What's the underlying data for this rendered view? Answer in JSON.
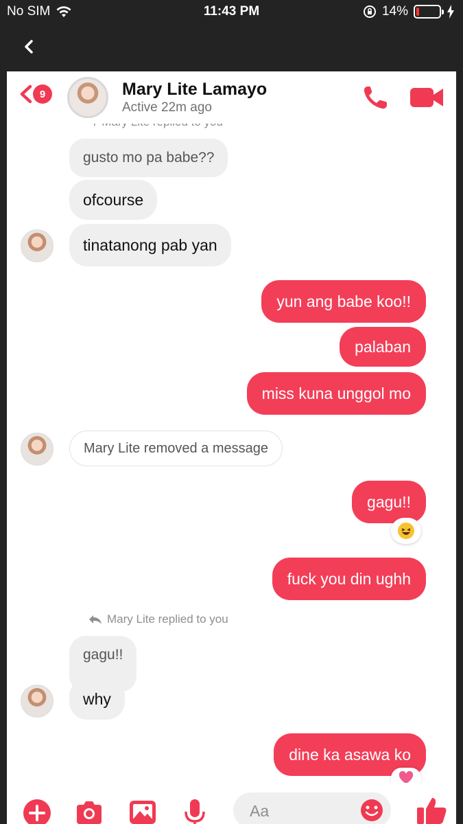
{
  "status_bar": {
    "carrier": "No SIM",
    "time": "11:43 PM",
    "battery_percent_label": "14%",
    "battery_level": 0.14
  },
  "outer_nav": {
    "back_icon": "chevron-left-icon"
  },
  "header": {
    "unread_count": "9",
    "contact_name": "Mary Lite Lamayo",
    "active_status": "Active 22m ago",
    "accent_color": "#f03a53"
  },
  "messages": {
    "reply_note_top": "Mary Lite replied to you",
    "incoming_1": "gusto mo pa babe??",
    "incoming_2": "ofcourse",
    "incoming_3": "tinatanong pab yan",
    "outgoing_1": "yun ang babe koo!!",
    "outgoing_2": "palaban",
    "outgoing_3": "miss kuna unggol mo",
    "removed_notice": "Mary Lite removed a message",
    "outgoing_4": "gagu!!",
    "reaction_4": "laughing-emoji",
    "outgoing_5": "fuck you din ughh",
    "reply_note_2": "Mary Lite replied to you",
    "quoted": "gagu!!",
    "incoming_4": "why",
    "outgoing_6": "dine ka asawa ko",
    "reaction_6": "heart-emoji"
  },
  "composer": {
    "placeholder": "Aa",
    "icons": [
      "plus-icon",
      "camera-icon",
      "image-icon",
      "microphone-icon",
      "emoji-icon",
      "thumbs-up-icon"
    ]
  }
}
